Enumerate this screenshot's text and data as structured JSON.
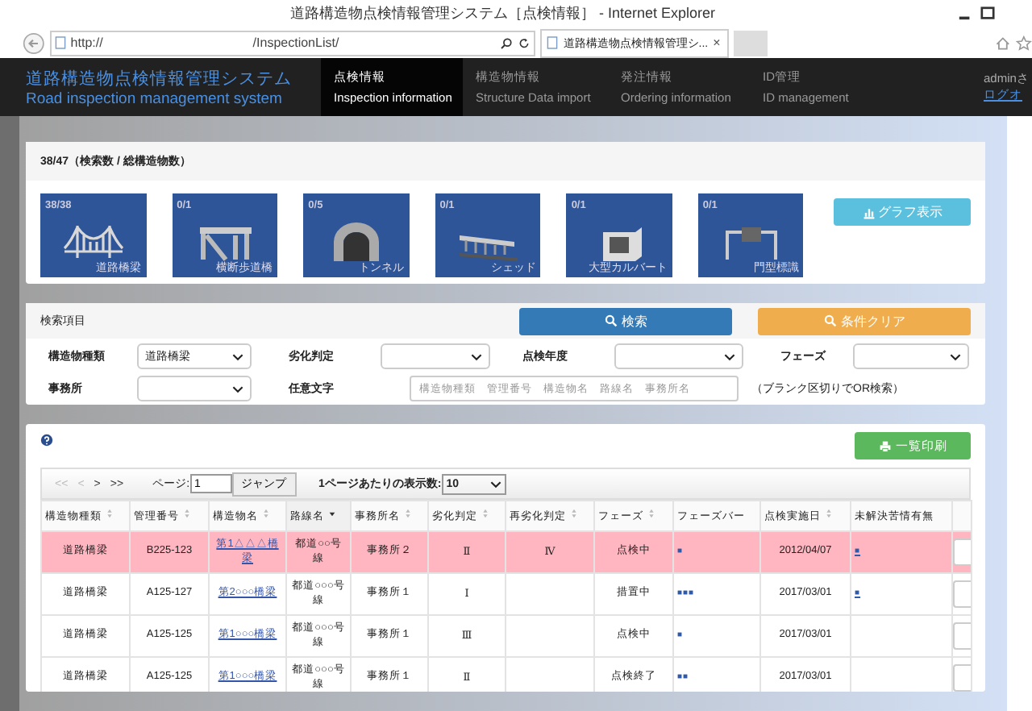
{
  "window": {
    "title": "道路構造物点検情報管理システム［点検情報］ - Internet Explorer"
  },
  "address_bar": {
    "scheme": "http://",
    "path": "/InspectionList/"
  },
  "browser_tab": {
    "title": "道路構造物点検情報管理シ...",
    "close": "×"
  },
  "app": {
    "title_ja": "道路構造物点検情報管理システム",
    "title_en": "Road inspection management system"
  },
  "nav": [
    {
      "ja": "点検情報",
      "en": "Inspection information",
      "selected": true
    },
    {
      "ja": "構造物情報",
      "en": "Structure Data import",
      "selected": false
    },
    {
      "ja": "発注情報",
      "en": "Ordering information",
      "selected": false
    },
    {
      "ja": "ID管理",
      "en": "ID management",
      "selected": false
    }
  ],
  "user": {
    "name": "adminさ",
    "logout": "ログオ"
  },
  "summary": {
    "header": "38/47（検索数 / 総構造物数）",
    "graph_button": "グラフ表示",
    "tiles": [
      {
        "count": "38/38",
        "label": "道路橋梁",
        "kind": "bridge"
      },
      {
        "count": "0/1",
        "label": "横断歩道橋",
        "kind": "footbridge"
      },
      {
        "count": "0/5",
        "label": "トンネル",
        "kind": "tunnel"
      },
      {
        "count": "0/1",
        "label": "シェッド",
        "kind": "shed"
      },
      {
        "count": "0/1",
        "label": "大型カルバート",
        "kind": "culvert"
      },
      {
        "count": "0/1",
        "label": "門型標識",
        "kind": "gantry"
      }
    ]
  },
  "search": {
    "header": "検索項目",
    "search_button": "検索",
    "clear_button": "条件クリア",
    "row1": [
      {
        "label": "構造物種類",
        "value": "道路橋梁"
      },
      {
        "label": "劣化判定"
      },
      {
        "label": "点検年度"
      },
      {
        "label": "フェーズ"
      }
    ],
    "office": {
      "label": "事務所"
    },
    "keyword": {
      "label": "任意文字",
      "placeholder": "構造物種類　管理番号　構造物名　路線名　事務所名"
    },
    "note": "（ブランク区切りでOR検索）"
  },
  "print_button": "一覧印刷",
  "pager": {
    "links": [
      {
        "text": "<<",
        "disabled": true
      },
      {
        "text": "<",
        "disabled": true
      },
      {
        "text": ">",
        "disabled": false
      },
      {
        "text": ">>",
        "disabled": false
      }
    ],
    "page_label": "ページ:",
    "page": "1",
    "jump": "ジャンプ",
    "per_page_label": "1ページあたりの表示数:",
    "per_page": "10"
  },
  "table": {
    "columns": [
      {
        "label": "構造物種類",
        "sortable": true,
        "sorted": false
      },
      {
        "label": "管理番号",
        "sortable": true,
        "sorted": false
      },
      {
        "label": "構造物名",
        "sortable": true,
        "sorted": false
      },
      {
        "label": "路線名",
        "sortable": true,
        "sorted": true
      },
      {
        "label": "事務所名",
        "sortable": true,
        "sorted": false
      },
      {
        "label": "劣化判定",
        "sortable": true,
        "sorted": false
      },
      {
        "label": "再劣化判定",
        "sortable": true,
        "sorted": false
      },
      {
        "label": "フェーズ",
        "sortable": true,
        "sorted": false
      },
      {
        "label": "フェーズバー",
        "sortable": false,
        "sorted": false
      },
      {
        "label": "点検実施日",
        "sortable": true,
        "sorted": false
      },
      {
        "label": "未解決苦情有無",
        "sortable": false,
        "sorted": false
      }
    ],
    "rows": [
      {
        "highlighted": true,
        "type": "道路橋梁",
        "id": "B225-123",
        "name": "第1△△△橋梁",
        "route": "都道○○号線",
        "office": "事務所２",
        "grade": "Ⅱ",
        "regrade": "Ⅳ",
        "phase": "点検中",
        "phase_bar": "■",
        "date": "2012/04/07",
        "unresolved": "■"
      },
      {
        "highlighted": false,
        "type": "道路橋梁",
        "id": "A125-127",
        "name": "第2○○○橋梁",
        "route": "都道○○○号線",
        "office": "事務所１",
        "grade": "Ⅰ",
        "phase": "措置中",
        "phase_bar": "■■■",
        "date": "2017/03/01",
        "unresolved": "■"
      },
      {
        "highlighted": false,
        "type": "道路橋梁",
        "id": "A125-125",
        "name": "第1○○○橋梁",
        "route": "都道○○○号線",
        "office": "事務所１",
        "grade": "Ⅲ",
        "phase": "点検中",
        "phase_bar": "■",
        "date": "2017/03/01"
      },
      {
        "highlighted": false,
        "type": "道路橋梁",
        "id": "A125-125",
        "name": "第1○○○橋梁",
        "route": "都道○○○号線",
        "office": "事務所１",
        "grade": "Ⅱ",
        "phase": "点検終了",
        "phase_bar": "■■",
        "date": "2017/03/01"
      }
    ]
  }
}
